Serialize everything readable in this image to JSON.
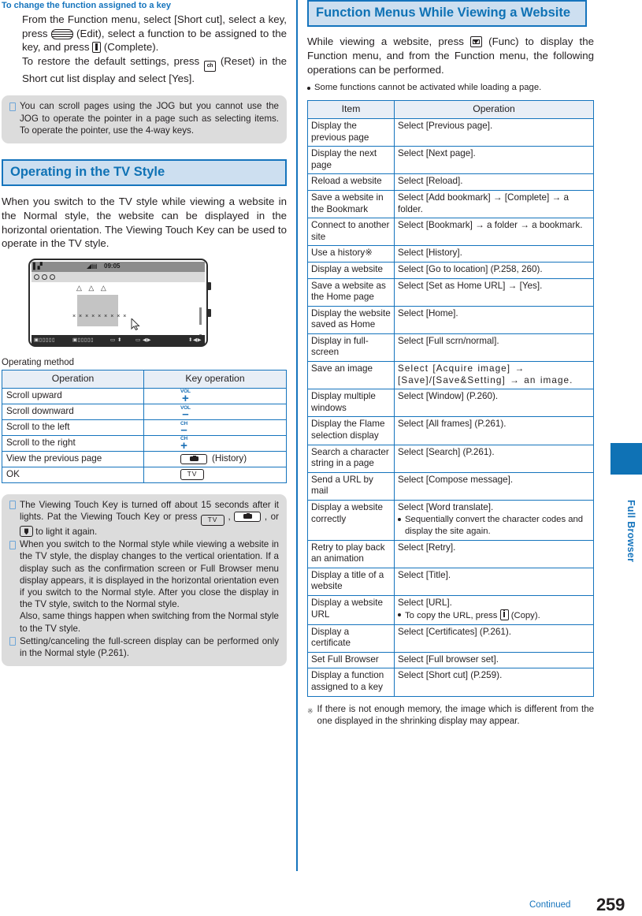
{
  "page": {
    "number": "259",
    "continued": "Continued",
    "edge_tab_label": "Full Browser",
    "accent_blue": "#1574bd",
    "head_bg": "#cddff0",
    "note_bg": "#dcdcdc"
  },
  "left": {
    "subheading": "To change the function assigned to a key",
    "para1_a": "From the Function menu, select [Short cut], select a key, press ",
    "para1_b": " (Edit), select a function to be assigned to the key, and press ",
    "para1_c": " (Complete).",
    "para2_a": "To restore the default settings, press ",
    "para2_b": " (Reset) in the Short cut list display and select [Yes].",
    "note1": "You can scroll pages using the JOG but you cannot use the JOG to operate the pointer in a page such as selecting items. To operate the pointer, use the 4-way keys.",
    "section_title": "Operating in the TV Style",
    "section_body": "When you switch to the TV style while viewing a website in the Normal style, the website can be displayed in the horizontal orientation. The Viewing Touch Key can be used to operate in the TV style.",
    "phone": {
      "clock": "09:05",
      "triangles": "△ △ △",
      "x_marks": "× × × × × × × × ×"
    },
    "table_caption": "Operating method",
    "table": {
      "headers": [
        "Operation",
        "Key operation"
      ],
      "rows": [
        {
          "operation": "Scroll upward",
          "key_label": "VOL",
          "key_sign": "+",
          "key_type": "volkey",
          "suffix": ""
        },
        {
          "operation": "Scroll downward",
          "key_label": "VOL",
          "key_sign": "–",
          "key_type": "volkey",
          "suffix": ""
        },
        {
          "operation": "Scroll to the left",
          "key_label": "CH",
          "key_sign": "–",
          "key_type": "volkey",
          "suffix": ""
        },
        {
          "operation": "Scroll to the right",
          "key_label": "CH",
          "key_sign": "+",
          "key_type": "volkey",
          "suffix": ""
        },
        {
          "operation": "View the previous page",
          "key_label": "",
          "key_sign": "",
          "key_type": "camera",
          "suffix": "(History)"
        },
        {
          "operation": "OK",
          "key_label": "TV",
          "key_sign": "",
          "key_type": "tv",
          "suffix": ""
        }
      ]
    },
    "notes": [
      {
        "parts": [
          "The Viewing Touch Key is turned off about 15 seconds after it lights. Pat the Viewing Touch Key or press ",
          " , ",
          " , or ",
          " to light it again."
        ]
      },
      {
        "text1": "When you switch to the Normal style while viewing a website in the TV style, the display changes to the vertical orientation. If a display such as the confirmation screen or Full Browser menu display appears, it is displayed in the horizontal orientation even if you switch to the Normal style. After you close the display in the TV style, switch to the Normal style.",
        "text2": "Also, same things happen when switching from the Normal style to the TV style."
      },
      {
        "text1": "Setting/canceling the full-screen display can be performed only in the Normal style (P.261)."
      }
    ]
  },
  "right": {
    "section_title": "Function Menus While Viewing a Website",
    "intro_a": "While viewing a website, press ",
    "intro_b": " (Func) to display the Function menu, and from the Function menu, the following operations can be performed.",
    "bullet1": "Some functions cannot be activated while loading a page.",
    "table": {
      "headers": [
        "Item",
        "Operation"
      ],
      "rows": [
        {
          "item": "Display the previous page",
          "op": "Select [Previous page]."
        },
        {
          "item": "Display the next page",
          "op": "Select [Next page]."
        },
        {
          "item": "Reload a website",
          "op": "Select [Reload]."
        },
        {
          "item": "Save a website in the Bookmark",
          "op": "Select [Add bookmark] → [Complete] → a folder."
        },
        {
          "item": "Connect to another site",
          "op": "Select [Bookmark] → a folder → a bookmark."
        },
        {
          "item": "Use a history※",
          "op": "Select [History]."
        },
        {
          "item": "Display a website",
          "op": "Select [Go to location] (P.258, 260)."
        },
        {
          "item": "Save a website as the Home page",
          "op": "Select [Set as Home URL] → [Yes]."
        },
        {
          "item": "Display the website saved as Home",
          "op": "Select [Home]."
        },
        {
          "item": "Display in full-screen",
          "op": "Select [Full scrn/normal]."
        },
        {
          "item": "Save an image",
          "op": "Select [Acquire image] → [Save]/[Save&Setting] → an image.",
          "spaced": true
        },
        {
          "item": "Display multiple windows",
          "op": "Select [Window] (P.260)."
        },
        {
          "item": "Display the Flame selection display",
          "op": "Select [All frames] (P.261)."
        },
        {
          "item": "Search a character string in a page",
          "op": "Select [Search] (P.261)."
        },
        {
          "item": "Send a URL by mail",
          "op": "Select [Compose message]."
        },
        {
          "item": "Display a website correctly",
          "op": "Select [Word translate].",
          "sub": "Sequentially convert the character codes and display the site again."
        },
        {
          "item": "Retry to play back an animation",
          "op": "Select [Retry]."
        },
        {
          "item": "Display a title of a website",
          "op": "Select [Title]."
        },
        {
          "item": "Display a website URL",
          "op": "Select [URL].",
          "sub_a": "To copy the URL, press ",
          "sub_b": " (Copy)."
        },
        {
          "item": "Display a certificate",
          "op": "Select [Certificates] (P.261)."
        },
        {
          "item": "Set Full Browser",
          "op": "Select [Full browser set]."
        },
        {
          "item": "Display a function assigned to a key",
          "op": "Select [Short cut] (P.259)."
        }
      ]
    },
    "footnote_mark": "※",
    "footnote": "If there is not enough memory, the image which is different from the one displayed in the shrinking display may appear."
  }
}
